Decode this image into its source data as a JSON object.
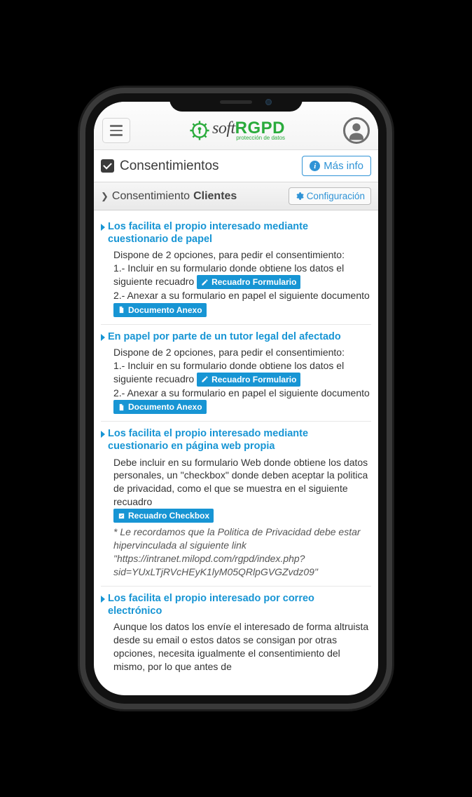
{
  "logo": {
    "soft": "soft",
    "rgpd": "RGPD",
    "sub": "protección de datos"
  },
  "title": "Consentimientos",
  "info_btn": "Más info",
  "sub": {
    "prefix": "Consentimiento",
    "strong": "Clientes",
    "config": "Configuración"
  },
  "badges": {
    "recuadro_form": "Recuadro Formulario",
    "documento_anexo": "Documento Anexo",
    "recuadro_checkbox": "Recuadro Checkbox"
  },
  "items": [
    {
      "title": "Los facilita el propio interesado mediante cuestionario de papel",
      "intro": "Dispone de 2 opciones, para pedir el consentimiento:",
      "line1a": "1.- Incluir en su formulario donde obtiene los datos el siguiente recuadro",
      "line2a": "2.- Anexar a su formulario en papel el siguiente documento"
    },
    {
      "title": "En papel por parte de un tutor legal del afectado",
      "intro": "Dispone de 2 opciones, para pedir el consentimiento:",
      "line1a": "1.- Incluir en su formulario donde obtiene los datos el siguiente recuadro",
      "line2a": "2.- Anexar a su formulario en papel el siguiente documento"
    },
    {
      "title": "Los facilita el propio interesado mediante cuestionario en página web propia",
      "text": "Debe incluir en su formulario Web donde obtiene los datos personales, un \"checkbox\" donde deben aceptar la politica de privacidad, como el que se muestra en el siguiente recuadro",
      "note": "* Le recordamos que la Politica de Privacidad debe estar hipervinculada al siguiente link \"https://intranet.milopd.com/rgpd/index.php?sid=YUxLTjRVcHEyK1lyM05QRlpGVGZvdz09\""
    },
    {
      "title": "Los facilita el propio interesado por correo electrónico",
      "text": "Aunque los datos los envíe el interesado de forma altruista desde su email o estos datos se consigan por otras opciones, necesita igualmente el consentimiento del mismo, por lo que antes de"
    }
  ]
}
